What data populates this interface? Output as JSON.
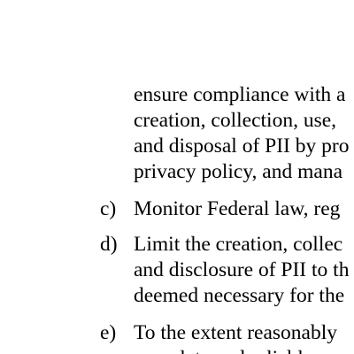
{
  "document": {
    "continuation_lines": [
      "ensure compliance with a",
      "creation, collection, use,",
      "and disposal of PII by pro",
      "privacy policy, and mana"
    ],
    "items": [
      {
        "marker": "c)",
        "lines": [
          "Monitor Federal law, reg"
        ]
      },
      {
        "marker": "d)",
        "lines": [
          "Limit the creation, collec",
          "and disclosure of PII to th",
          "deemed necessary for the"
        ]
      },
      {
        "marker": "e)",
        "lines": [
          "To the extent reasonably",
          "complete and reliable ..."
        ]
      }
    ]
  }
}
